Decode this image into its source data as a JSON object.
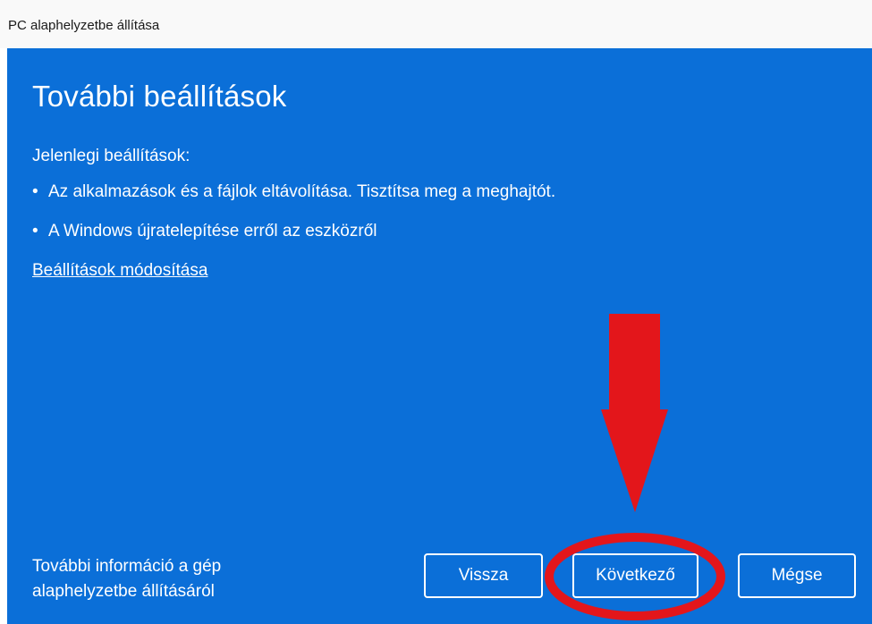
{
  "window": {
    "title": "PC alaphelyzetbe állítása"
  },
  "main": {
    "heading": "További beállítások",
    "current_settings_label": "Jelenlegi beállítások:",
    "settings": [
      "Az alkalmazások és a fájlok eltávolítása. Tisztítsa meg a meghajtót.",
      "A Windows újratelepítése erről az eszközről"
    ],
    "change_settings_link": "Beállítások módosítása"
  },
  "footer": {
    "info_link": "További információ a gép alaphelyzetbe állításáról",
    "back_label": "Vissza",
    "next_label": "Következő",
    "cancel_label": "Mégse"
  },
  "colors": {
    "panel_background": "#0b6fd8",
    "annotation_red": "#e3161b",
    "title_bar": "#f9f9f9"
  },
  "annotation": {
    "arrow": "red-down-arrow",
    "highlight": "red-ellipse-around-next-button"
  }
}
